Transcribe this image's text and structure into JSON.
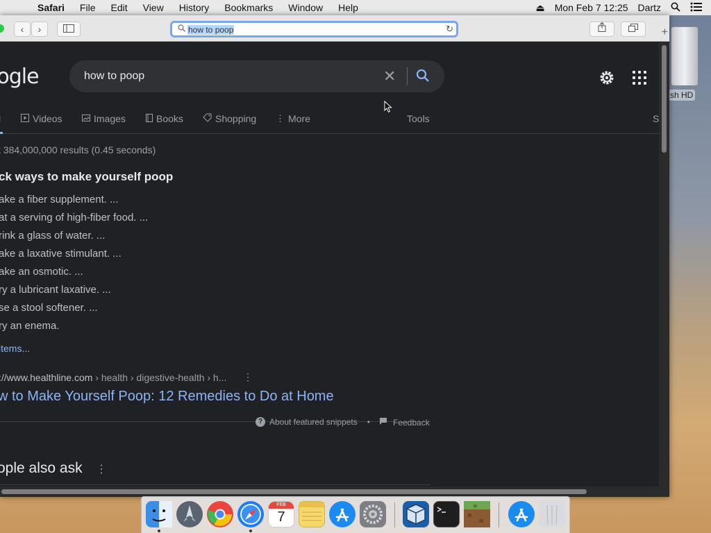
{
  "menubar": {
    "apple_symbol": "",
    "app_name": "Safari",
    "items": [
      "File",
      "Edit",
      "View",
      "History",
      "Bookmarks",
      "Window",
      "Help"
    ],
    "datetime": "Mon Feb 7  12:25",
    "user": "Dartz"
  },
  "desktop": {
    "disk_label": "sh HD"
  },
  "toolbar": {
    "back_symbol": "‹",
    "forward_symbol": "›",
    "address_text": "how to poop"
  },
  "google": {
    "logo_text": "oogle",
    "query": "how to poop",
    "tabs": [
      {
        "label": "l",
        "icon": "all-search-icon"
      },
      {
        "label": "Videos",
        "icon": "video-icon"
      },
      {
        "label": "Images",
        "icon": "image-icon"
      },
      {
        "label": "Books",
        "icon": "book-icon"
      },
      {
        "label": "Shopping",
        "icon": "tag-icon"
      },
      {
        "label": "More",
        "icon": "more-vert-icon"
      },
      {
        "label": "Tools",
        "icon": ""
      },
      {
        "label": "S",
        "icon": ""
      }
    ],
    "stats": "t 384,000,000 results (0.45 seconds)",
    "snippet_title": "ck ways to make yourself poop",
    "snippet_items": [
      "ake a fiber supplement. ...",
      "at a serving of high-fiber food. ...",
      "rink a glass of water. ...",
      "ake a laxative stimulant. ...",
      "ake an osmotic. ...",
      "ry a lubricant laxative. ...",
      "se a stool softener. ...",
      "ry an enema."
    ],
    "more_items": " items...",
    "cite_domain": "://www.healthline.com",
    "cite_path": " › health › digestive-health › h...",
    "result_title": "w to Make Yourself Poop: 12 Remedies to Do at Home",
    "about_snippets": "About featured snippets",
    "bullet": "•",
    "feedback": "Feedback",
    "people_also_ask": "ople also ask"
  },
  "dock": {
    "items": [
      "Finder",
      "Launchpad",
      "Chrome",
      "Safari",
      "Calendar",
      "Notes",
      "App Store",
      "System Preferences",
      "VirtualBox",
      "Terminal",
      "Minecraft",
      "App Store",
      "Trash"
    ],
    "calendar_month": "FEB",
    "calendar_day": "7",
    "colors": {
      "finder": "#3b8ee8",
      "launchpad": "#5a6470",
      "chrome": "#e8453c",
      "safari": "#1e7cf2",
      "calendar": "#ffffff",
      "notes": "#f6d86b",
      "appstore": "#1a8cf0",
      "sysprefs": "#7d7f84",
      "virtualbox": "#1c5fa8",
      "terminal": "#1e1e1e",
      "minecraft": "#5b8c3a",
      "trash": "#d9dbde"
    }
  }
}
